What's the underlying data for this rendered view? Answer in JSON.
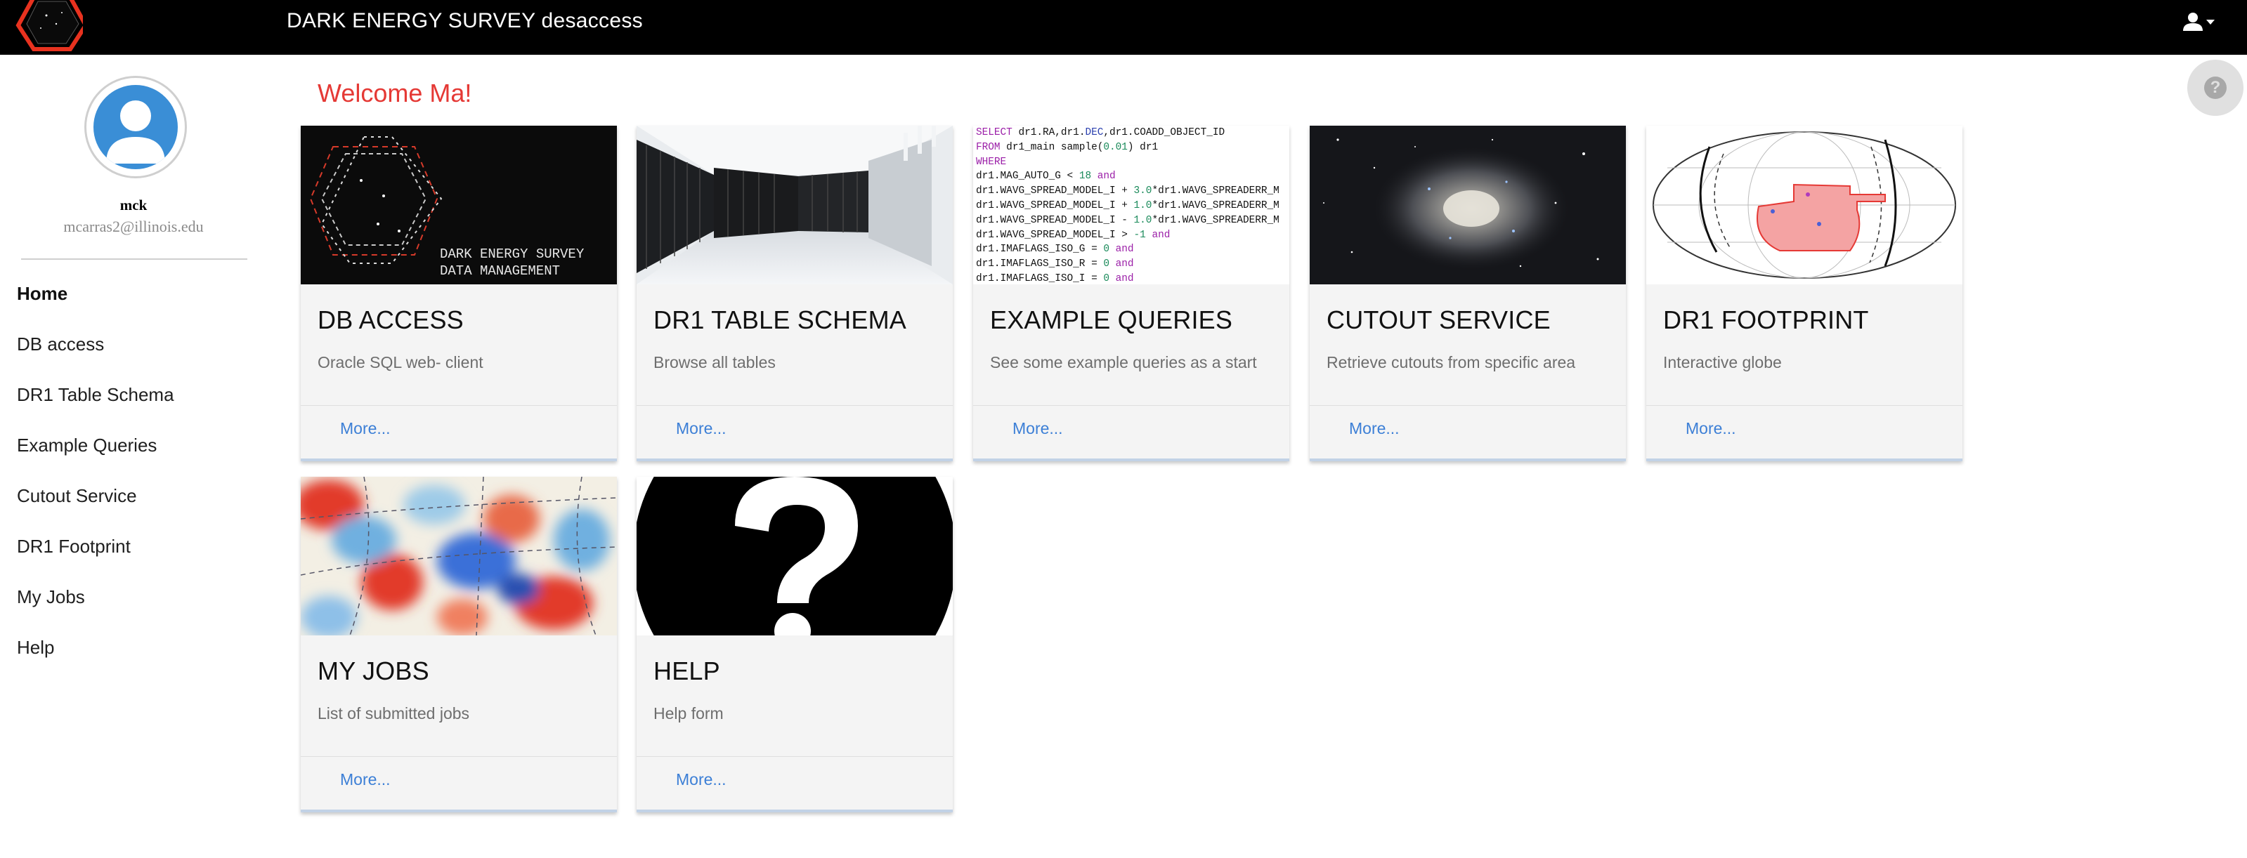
{
  "header": {
    "title": "DARK ENERGY SURVEY desaccess"
  },
  "profile": {
    "name": "mck",
    "email": "mcarras2@illinois.edu"
  },
  "sidebar": {
    "items": [
      {
        "label": "Home",
        "active": true
      },
      {
        "label": "DB access"
      },
      {
        "label": "DR1 Table Schema"
      },
      {
        "label": "Example Queries"
      },
      {
        "label": "Cutout Service"
      },
      {
        "label": "DR1 Footprint"
      },
      {
        "label": "My Jobs"
      },
      {
        "label": "Help"
      }
    ]
  },
  "main": {
    "welcome": "Welcome Ma!",
    "cards": [
      {
        "title": "DB ACCESS",
        "description": "Oracle SQL web- client",
        "more": "More...",
        "image_text": [
          "DARK ENERGY SURVEY",
          "DATA MANAGEMENT"
        ]
      },
      {
        "title": "DR1 TABLE SCHEMA",
        "description": "Browse all tables",
        "more": "More..."
      },
      {
        "title": "EXAMPLE QUERIES",
        "description": "See some example queries as a start",
        "more": "More..."
      },
      {
        "title": "CUTOUT SERVICE",
        "description": "Retrieve cutouts from specific area",
        "more": "More..."
      },
      {
        "title": "DR1 FOOTPRINT",
        "description": "Interactive globe",
        "more": "More..."
      },
      {
        "title": "MY JOBS",
        "description": "List of submitted jobs",
        "more": "More..."
      },
      {
        "title": "HELP",
        "description": "Help form",
        "more": "More..."
      }
    ],
    "query_lines": [
      {
        "parts": [
          {
            "t": "SELECT",
            "c": "kw"
          },
          {
            "t": " dr1.RA,dr1."
          },
          {
            "t": "DEC",
            "c": "fn"
          },
          {
            "t": ",dr1.COADD_OBJECT_ID"
          }
        ]
      },
      {
        "parts": [
          {
            "t": "FROM",
            "c": "kw"
          },
          {
            "t": " dr1_main sample("
          },
          {
            "t": "0.01",
            "c": "num"
          },
          {
            "t": ") dr1"
          }
        ]
      },
      {
        "parts": [
          {
            "t": "WHERE",
            "c": "kw"
          }
        ]
      },
      {
        "parts": [
          {
            "t": "dr1.MAG_AUTO_G < "
          },
          {
            "t": "18",
            "c": "num"
          },
          {
            "t": " "
          },
          {
            "t": "and",
            "c": "kw"
          }
        ]
      },
      {
        "parts": [
          {
            "t": "dr1.WAVG_SPREAD_MODEL_I + "
          },
          {
            "t": "3.0",
            "c": "num"
          },
          {
            "t": "*dr1.WAVG_SPREADERR_M"
          }
        ]
      },
      {
        "parts": [
          {
            "t": "dr1.WAVG_SPREAD_MODEL_I + "
          },
          {
            "t": "1.0",
            "c": "num"
          },
          {
            "t": "*dr1.WAVG_SPREADERR_M"
          }
        ]
      },
      {
        "parts": [
          {
            "t": "dr1.WAVG_SPREAD_MODEL_I - "
          },
          {
            "t": "1.0",
            "c": "num"
          },
          {
            "t": "*dr1.WAVG_SPREADERR_M"
          }
        ]
      },
      {
        "parts": [
          {
            "t": "dr1.WAVG_SPREAD_MODEL_I > "
          },
          {
            "t": "-1",
            "c": "num"
          },
          {
            "t": " "
          },
          {
            "t": "and",
            "c": "kw"
          }
        ]
      },
      {
        "parts": [
          {
            "t": "dr1.IMAFLAGS_ISO_G = "
          },
          {
            "t": "0",
            "c": "num"
          },
          {
            "t": " "
          },
          {
            "t": "and",
            "c": "kw"
          }
        ]
      },
      {
        "parts": [
          {
            "t": "dr1.IMAFLAGS_ISO_R = "
          },
          {
            "t": "0",
            "c": "num"
          },
          {
            "t": " "
          },
          {
            "t": "and",
            "c": "kw"
          }
        ]
      },
      {
        "parts": [
          {
            "t": "dr1.IMAFLAGS_ISO_I = "
          },
          {
            "t": "0",
            "c": "num"
          },
          {
            "t": " "
          },
          {
            "t": "and",
            "c": "kw"
          }
        ]
      }
    ]
  },
  "icons": {
    "logo": "des-hexagon-logo",
    "user_menu": "account-dropdown-icon",
    "help": "help-circle-icon",
    "avatar": "user-avatar-icon"
  },
  "colors": {
    "topbar": "#000000",
    "welcome": "#e53935",
    "link": "#3c7fd6",
    "card_bg": "#f4f4f4",
    "avatar": "#3a8ed6"
  }
}
